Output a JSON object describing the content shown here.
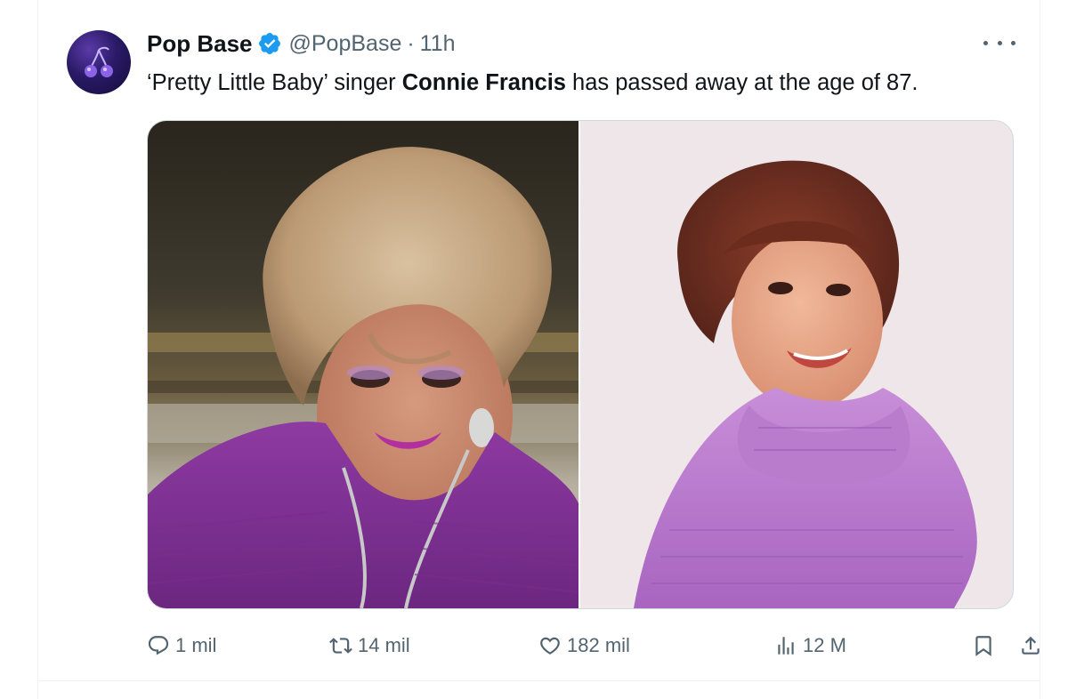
{
  "author": {
    "name": "Pop Base",
    "handle": "@PopBase",
    "separator": "·",
    "time": "11h",
    "verified_icon": "verified-badge-icon",
    "avatar_icon": "cherries-logo"
  },
  "tweet": {
    "text_before": "‘Pretty Little Baby’ singer ",
    "text_bold": "Connie Francis",
    "text_after": " has passed away at the age of 87."
  },
  "media": {
    "count": 2,
    "images": [
      "older-portrait-photo",
      "vintage-portrait-photo"
    ]
  },
  "actions": {
    "replies": "1 mil",
    "retweets": "14 mil",
    "likes": "182 mil",
    "views": "12 M",
    "bookmark_icon": "bookmark-icon",
    "share_icon": "share-icon"
  },
  "colors": {
    "text": "#0f1419",
    "secondary": "#536471",
    "verified": "#1d9bf0",
    "border": "#cfd9de"
  }
}
